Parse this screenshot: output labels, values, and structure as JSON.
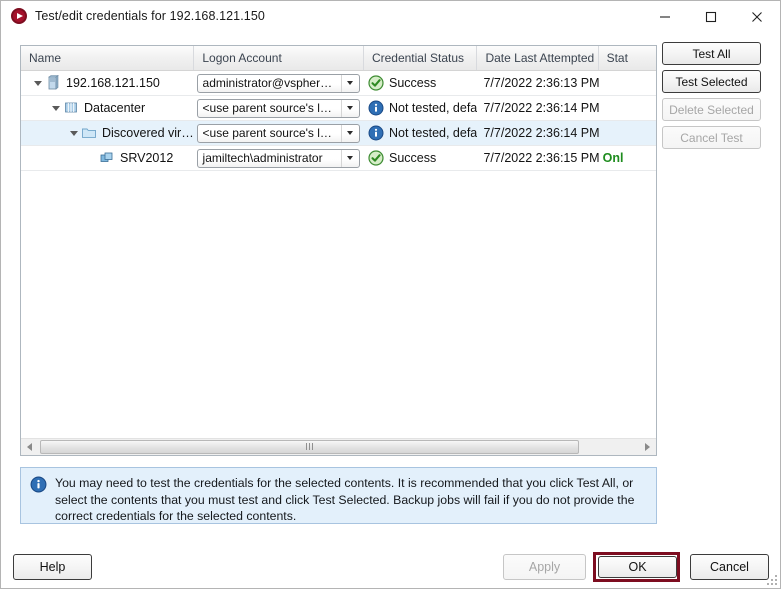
{
  "window": {
    "title": "Test/edit credentials for 192.168.121.150",
    "icon": "app-record-icon",
    "minimize_label": "—",
    "maximize_label": "□",
    "close_label": "✕"
  },
  "table": {
    "columns": [
      {
        "key": "name",
        "label": "Name"
      },
      {
        "key": "logon",
        "label": "Logon Account"
      },
      {
        "key": "cred",
        "label": "Credential Status"
      },
      {
        "key": "date",
        "label": "Date Last Attempted"
      },
      {
        "key": "status",
        "label": "Stat"
      }
    ],
    "rows": [
      {
        "name": "192.168.121.150",
        "icon": "server-icon",
        "depth": 0,
        "expanded": true,
        "logon_account": "administrator@vspher…",
        "credential_status": "Success",
        "credential_icon": "success-check-icon",
        "date_last_attempted": "7/7/2022 2:36:13 PM",
        "status": "",
        "selected": false
      },
      {
        "name": "Datacenter",
        "icon": "datacenter-icon",
        "depth": 1,
        "expanded": true,
        "logon_account": "<use parent source's l…",
        "credential_status": "Not tested, defaı",
        "credential_icon": "info-circle-icon",
        "date_last_attempted": "7/7/2022 2:36:14 PM",
        "status": "",
        "selected": false
      },
      {
        "name": "Discovered virt…",
        "icon": "folder-icon",
        "depth": 2,
        "expanded": true,
        "logon_account": "<use parent source's l…",
        "credential_status": "Not tested, defaı",
        "credential_icon": "info-circle-icon",
        "date_last_attempted": "7/7/2022 2:36:14 PM",
        "status": "",
        "selected": true
      },
      {
        "name": "SRV2012",
        "icon": "virtual-machine-icon",
        "depth": 3,
        "expanded": null,
        "logon_account": "jamiltech\\administrator",
        "credential_status": "Success",
        "credential_icon": "success-check-icon",
        "date_last_attempted": "7/7/2022 2:36:15 PM",
        "status": "Onl",
        "selected": false
      }
    ]
  },
  "side_buttons": {
    "test_all": "Test All",
    "test_selected": "Test Selected",
    "delete_selected": "Delete Selected",
    "cancel_test": "Cancel Test"
  },
  "info": {
    "icon": "info-circle-icon",
    "message": "You may need to test the credentials for the selected contents. It is recommended that you click Test All, or select the contents that you must test and click Test Selected. Backup jobs will fail if you do not provide the correct credentials for the selected contents."
  },
  "footer": {
    "help": "Help",
    "apply": "Apply",
    "ok": "OK",
    "cancel": "Cancel"
  },
  "colors": {
    "accent_red": "#7d0d20",
    "selection_blue": "#e6f2fb",
    "info_bg": "#e3f0fb",
    "success_green": "#3faa3f",
    "online_green": "#1e8c1e"
  }
}
